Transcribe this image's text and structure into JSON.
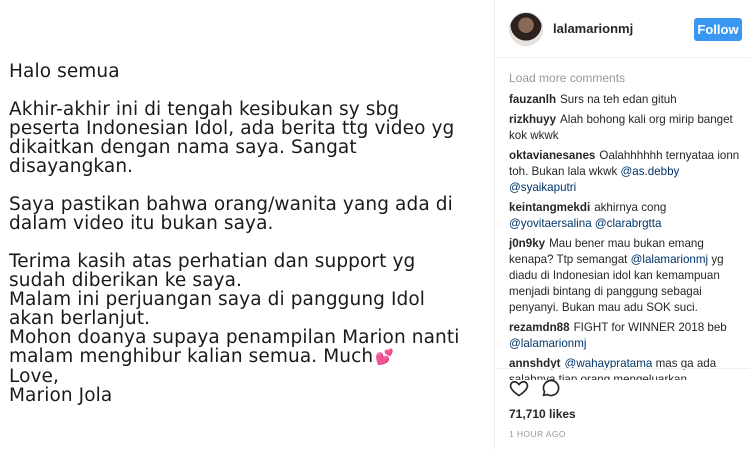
{
  "post": {
    "paragraphs": [
      [
        "Halo semua"
      ],
      [
        "Akhir-akhir ini di tengah kesibukan sy sbg",
        "peserta Indonesian Idol, ada berita ttg video yg",
        "dikaitkan dengan nama saya. Sangat",
        "disayangkan."
      ],
      [
        "Saya pastikan bahwa orang/wanita yang ada di",
        "dalam video itu bukan saya."
      ],
      [
        "Terima kasih atas perhatian dan support yg",
        "sudah diberikan ke saya.",
        "Malam ini perjuangan saya di panggung Idol",
        "akan berlanjut.",
        "Mohon doanya supaya penampilan Marion nanti",
        "malam menghibur kalian semua. Much",
        "Love,",
        "Marion Jola"
      ]
    ],
    "heart_emoji": "💕"
  },
  "header": {
    "username": "lalamarionmj",
    "follow_label": "Follow"
  },
  "comments": {
    "load_more": "Load more comments",
    "items": [
      {
        "author": "fauzanlh",
        "segments": [
          {
            "t": "Surs na teh edan gituh",
            "m": false
          }
        ]
      },
      {
        "author": "rizkhuyy",
        "segments": [
          {
            "t": "Alah bohong kali org mirip banget kok wkwk",
            "m": false
          }
        ]
      },
      {
        "author": "oktavianesanes",
        "segments": [
          {
            "t": "Oalahhhhhh ternyataa ionn toh. Bukan lala wkwk ",
            "m": false
          },
          {
            "t": "@as.debby",
            "m": true
          },
          {
            "t": " ",
            "m": false
          },
          {
            "t": "@syaikaputri",
            "m": true
          }
        ]
      },
      {
        "author": "keintangmekdi",
        "segments": [
          {
            "t": "akhirnya cong ",
            "m": false
          },
          {
            "t": "@yovitaersalina",
            "m": true
          },
          {
            "t": " ",
            "m": false
          },
          {
            "t": "@clarabrgtta",
            "m": true
          }
        ]
      },
      {
        "author": "j0n9ky",
        "segments": [
          {
            "t": "Mau bener mau bukan emang kenapa? Ttp semangat ",
            "m": false
          },
          {
            "t": "@lalamarionmj",
            "m": true
          },
          {
            "t": " yg diadu di Indonesian idol kan kemampuan menjadi bintang di panggung sebagai penyanyi. Bukan mau adu SOK suci.",
            "m": false
          }
        ]
      },
      {
        "author": "rezamdn88",
        "segments": [
          {
            "t": "FIGHT for WINNER 2018 beb ",
            "m": false
          },
          {
            "t": "@lalamarionmj",
            "m": true
          }
        ]
      },
      {
        "author": "annshdyt",
        "segments": [
          {
            "t": "@wahaypratama",
            "m": true
          },
          {
            "t": " mas ga ada salahnya tiap orang mengeluarkan",
            "m": false
          }
        ]
      }
    ]
  },
  "footer": {
    "likes": "71,710 likes",
    "timestamp": "1 HOUR AGO"
  }
}
